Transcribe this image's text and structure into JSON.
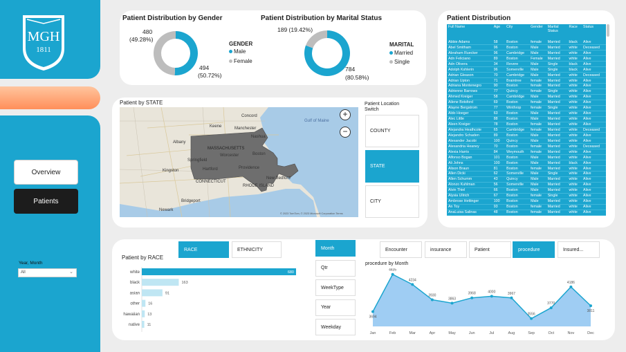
{
  "sidebar": {
    "logo": {
      "name": "MGH",
      "year": "1811"
    },
    "nav": [
      {
        "label": "Overview",
        "active": false
      },
      {
        "label": "Patients",
        "active": true
      }
    ],
    "filter": {
      "label": "Year, Month",
      "value": "All"
    }
  },
  "gender_card": {
    "title": "Patient Distribution by Gender",
    "legend_title": "GENDER",
    "legend": [
      {
        "label": "Male",
        "color": "#1ba5cf"
      },
      {
        "label": "Female",
        "color": "#bdbdbd"
      }
    ],
    "female_label": "480",
    "female_pct": "(49.28%)",
    "male_label": "494",
    "male_pct": "(50.72%)"
  },
  "marital_card": {
    "title": "Patient Distribution by Marital Status",
    "legend_title": "MARITAL",
    "legend": [
      {
        "label": "Married",
        "color": "#1ba5cf"
      },
      {
        "label": "Single",
        "color": "#bdbdbd"
      }
    ],
    "single_label": "189 (19.42%)",
    "married_label": "784",
    "married_pct": "(80.58%)"
  },
  "map_card": {
    "title": "Patient by STATE",
    "switch_title": "Patient Location Switch",
    "switch_options": [
      {
        "label": "COUNTY",
        "active": false
      },
      {
        "label": "STATE",
        "active": true
      },
      {
        "label": "CITY",
        "active": false
      }
    ],
    "zoom_in": "+",
    "zoom_out": "−",
    "labels": [
      {
        "text": "Gulf of Maine"
      },
      {
        "text": "Manchester"
      },
      {
        "text": "Keene"
      },
      {
        "text": "Albany"
      },
      {
        "text": "MASSACHUSETTS"
      },
      {
        "text": "Boston"
      },
      {
        "text": "Springfield"
      },
      {
        "text": "Worcester"
      },
      {
        "text": "Hartford"
      },
      {
        "text": "Providence"
      },
      {
        "text": "CONNECTICUT"
      },
      {
        "text": "RHODE ISLAND"
      },
      {
        "text": "New Bedford"
      },
      {
        "text": "Bridgeport"
      },
      {
        "text": "Kingston"
      },
      {
        "text": "Newark"
      },
      {
        "text": "Nashua"
      },
      {
        "text": "Concord"
      }
    ],
    "copyright": "© 2023 TomTom, © 2023 Microsoft Corporation  Terms"
  },
  "distribution_table": {
    "title": "Patient Distribution",
    "columns": [
      "Full Name",
      "Age",
      "City",
      "Gender",
      "Marital Status",
      "Race",
      "Status"
    ],
    "rows": [
      [
        "Abbie Adams",
        "58",
        "Boston",
        "female",
        "Married",
        "black",
        "Alive"
      ],
      [
        "Abel Smitham",
        "96",
        "Boston",
        "Male",
        "Married",
        "white",
        "Deceased"
      ],
      [
        "Abraham Ruecker",
        "96",
        "Cambridge",
        "Male",
        "Married",
        "white",
        "Alive"
      ],
      [
        "Adn Feliciano",
        "89",
        "Boston",
        "Female",
        "Married",
        "white",
        "Alive"
      ],
      [
        "Adn Olivera",
        "34",
        "Revere",
        "Male",
        "Single",
        "black",
        "Alive"
      ],
      [
        "Adolph Kshlerin",
        "96",
        "Somerville",
        "Male",
        "Single",
        "black",
        "Alive"
      ],
      [
        "Adrian Gleason",
        "70",
        "Cambridge",
        "Male",
        "Married",
        "white",
        "Deceased"
      ],
      [
        "Adrian Upton",
        "71",
        "Braintree",
        "female",
        "Married",
        "white",
        "Alive"
      ],
      [
        "Adriana Montenegro",
        "90",
        "Boston",
        "female",
        "Married",
        "white",
        "Alive"
      ],
      [
        "Adrienne Barrows",
        "77",
        "Quincy",
        "female",
        "Single",
        "white",
        "Alive"
      ],
      [
        "Ahmed Kreiger",
        "58",
        "Cambridge",
        "Male",
        "Married",
        "white",
        "Alive"
      ],
      [
        "Ailene Botsford",
        "69",
        "Boston",
        "female",
        "Married",
        "white",
        "Alive"
      ],
      [
        "Alayne Bergstrom",
        "77",
        "Winthrop",
        "female",
        "Single",
        "white",
        "Alive"
      ],
      [
        "Aldo Hoeger",
        "63",
        "Boston",
        "Male",
        "Married",
        "white",
        "Alive"
      ],
      [
        "Alec Little",
        "88",
        "Boston",
        "Male",
        "Married",
        "white",
        "Alive"
      ],
      [
        "Aleen Kreiger",
        "78",
        "Boston",
        "female",
        "Married",
        "white",
        "Alive"
      ],
      [
        "Alejandra Heathcote",
        "65",
        "Cambridge",
        "female",
        "Married",
        "white",
        "Deceased"
      ],
      [
        "Alejandro Schaden",
        "89",
        "Boston",
        "Male",
        "Married",
        "white",
        "Alive"
      ],
      [
        "Alexander Jacobi",
        "100",
        "Quincy",
        "Male",
        "Married",
        "white",
        "Alive"
      ],
      [
        "Alexandria Heaney",
        "70",
        "Boston",
        "female",
        "Married",
        "white",
        "Deceased"
      ],
      [
        "Alexia Harris",
        "84",
        "Weymouth",
        "female",
        "Married",
        "white",
        "Alive"
      ],
      [
        "Alfonso Bogan",
        "101",
        "Boston",
        "Male",
        "Married",
        "white",
        "Alive"
      ],
      [
        "Ali Johns",
        "100",
        "Boston",
        "Male",
        "Married",
        "black",
        "Alive"
      ],
      [
        "Alison Braun",
        "81",
        "Boston",
        "female",
        "Married",
        "white",
        "Alive"
      ],
      [
        "Allen Dicki",
        "62",
        "Somerville",
        "Male",
        "Single",
        "white",
        "Alive"
      ],
      [
        "Allen Schumm",
        "43",
        "Quincy",
        "Male",
        "Married",
        "white",
        "Alive"
      ],
      [
        "Alonzo Kuhlman",
        "56",
        "Somerville",
        "Male",
        "Married",
        "white",
        "Alive"
      ],
      [
        "Alvin Thiel",
        "66",
        "Boston",
        "Male",
        "Married",
        "white",
        "Alive"
      ],
      [
        "Alysia Ullrich",
        "67",
        "Boston",
        "female",
        "Single",
        "white",
        "Alive"
      ],
      [
        "Ambrose Hettinger",
        "100",
        "Boston",
        "Male",
        "Married",
        "white",
        "Alive"
      ],
      [
        "An Toy",
        "93",
        "Boston",
        "female",
        "Married",
        "white",
        "Alive"
      ],
      [
        "AnaLuisa Salinas",
        "48",
        "Boston",
        "female",
        "Married",
        "white",
        "Alive"
      ]
    ]
  },
  "race_card": {
    "title": "Patient by RACE",
    "tabs": [
      {
        "label": "RACE",
        "active": true
      },
      {
        "label": "ETHNICITY",
        "active": false
      }
    ]
  },
  "time_slicer": {
    "options": [
      {
        "label": "Month",
        "active": true
      },
      {
        "label": "Qtr",
        "active": false
      },
      {
        "label": "WeekType",
        "active": false
      },
      {
        "label": "Year",
        "active": false
      },
      {
        "label": "Weekday",
        "active": false
      }
    ]
  },
  "procedure_card": {
    "tabs": [
      {
        "label": "Encounter",
        "active": false
      },
      {
        "label": "insurance",
        "active": false
      },
      {
        "label": "Patient",
        "active": false
      },
      {
        "label": "procedure",
        "active": true
      },
      {
        "label": "Insured...",
        "active": false
      }
    ],
    "title": "procedure by Month"
  },
  "chart_data": [
    {
      "type": "pie",
      "title": "Patient Distribution by Gender",
      "categories": [
        "Male",
        "Female"
      ],
      "values": [
        494,
        480
      ],
      "percent": [
        50.72,
        49.28
      ],
      "colors": [
        "#1ba5cf",
        "#bdbdbd"
      ]
    },
    {
      "type": "pie",
      "title": "Patient Distribution by Marital Status",
      "categories": [
        "Married",
        "Single"
      ],
      "values": [
        784,
        189
      ],
      "percent": [
        80.58,
        19.42
      ],
      "colors": [
        "#1ba5cf",
        "#bdbdbd"
      ]
    },
    {
      "type": "bar",
      "orientation": "horizontal",
      "title": "Patient by RACE",
      "categories": [
        "white",
        "black",
        "asian",
        "other",
        "hawaiian",
        "native"
      ],
      "values": [
        680,
        163,
        91,
        16,
        13,
        11
      ],
      "colors": {
        "white": "#1ba5cf",
        "other": "#bfe6f3"
      }
    },
    {
      "type": "area",
      "title": "procedure by Month",
      "categories": [
        "Jan",
        "Feb",
        "Mar",
        "Apr",
        "May",
        "Jun",
        "Jul",
        "Aug",
        "Sep",
        "Oct",
        "Nov",
        "Dec"
      ],
      "values": [
        3694,
        4435,
        4234,
        3930,
        3863,
        3968,
        4000,
        3967,
        3556,
        3770,
        4186,
        3811
      ],
      "ylim": [
        3400,
        4500
      ],
      "grid": false,
      "colors": {
        "line": "#1ba5cf",
        "fill": "#9fcdf3"
      }
    }
  ]
}
